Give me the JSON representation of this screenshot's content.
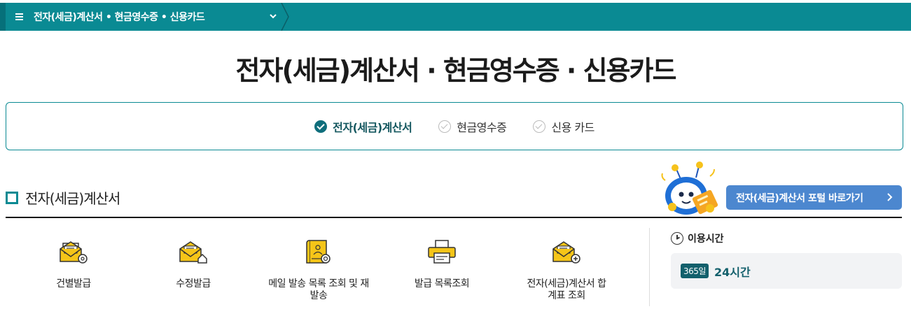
{
  "nav": {
    "breadcrumb": "전자(세금)계산서 • 현금영수증 • 신용카드"
  },
  "page": {
    "title": "전자(세금)계산서 · 현금영수증 · 신용카드"
  },
  "tabs": [
    {
      "label": "전자(세금)계산서",
      "active": true
    },
    {
      "label": "현금영수증",
      "active": false
    },
    {
      "label": "신용 카드",
      "active": false
    }
  ],
  "section": {
    "title": "전자(세금)계산서",
    "portal_button": "전자(세금)계산서 포털 바로가기"
  },
  "menu": [
    {
      "label": "건별발급",
      "icon": "envelope-gear-icon"
    },
    {
      "label": "수정발급",
      "icon": "envelope-house-icon"
    },
    {
      "label": "메일 발송 목록 조회 및 재발송",
      "icon": "document-search-icon"
    },
    {
      "label": "발급 목록조회",
      "icon": "printer-icon"
    },
    {
      "label": "전자(세금)계산서 합계표 조회",
      "icon": "envelope-plus-icon"
    }
  ],
  "usage": {
    "heading": "이용시간",
    "days_badge": "365일",
    "hours": "24시간"
  },
  "colors": {
    "teal": "#0a8a93",
    "dark_teal": "#13606c",
    "portal_blue": "#4c87cf",
    "icon_yellow": "#f5c518"
  }
}
